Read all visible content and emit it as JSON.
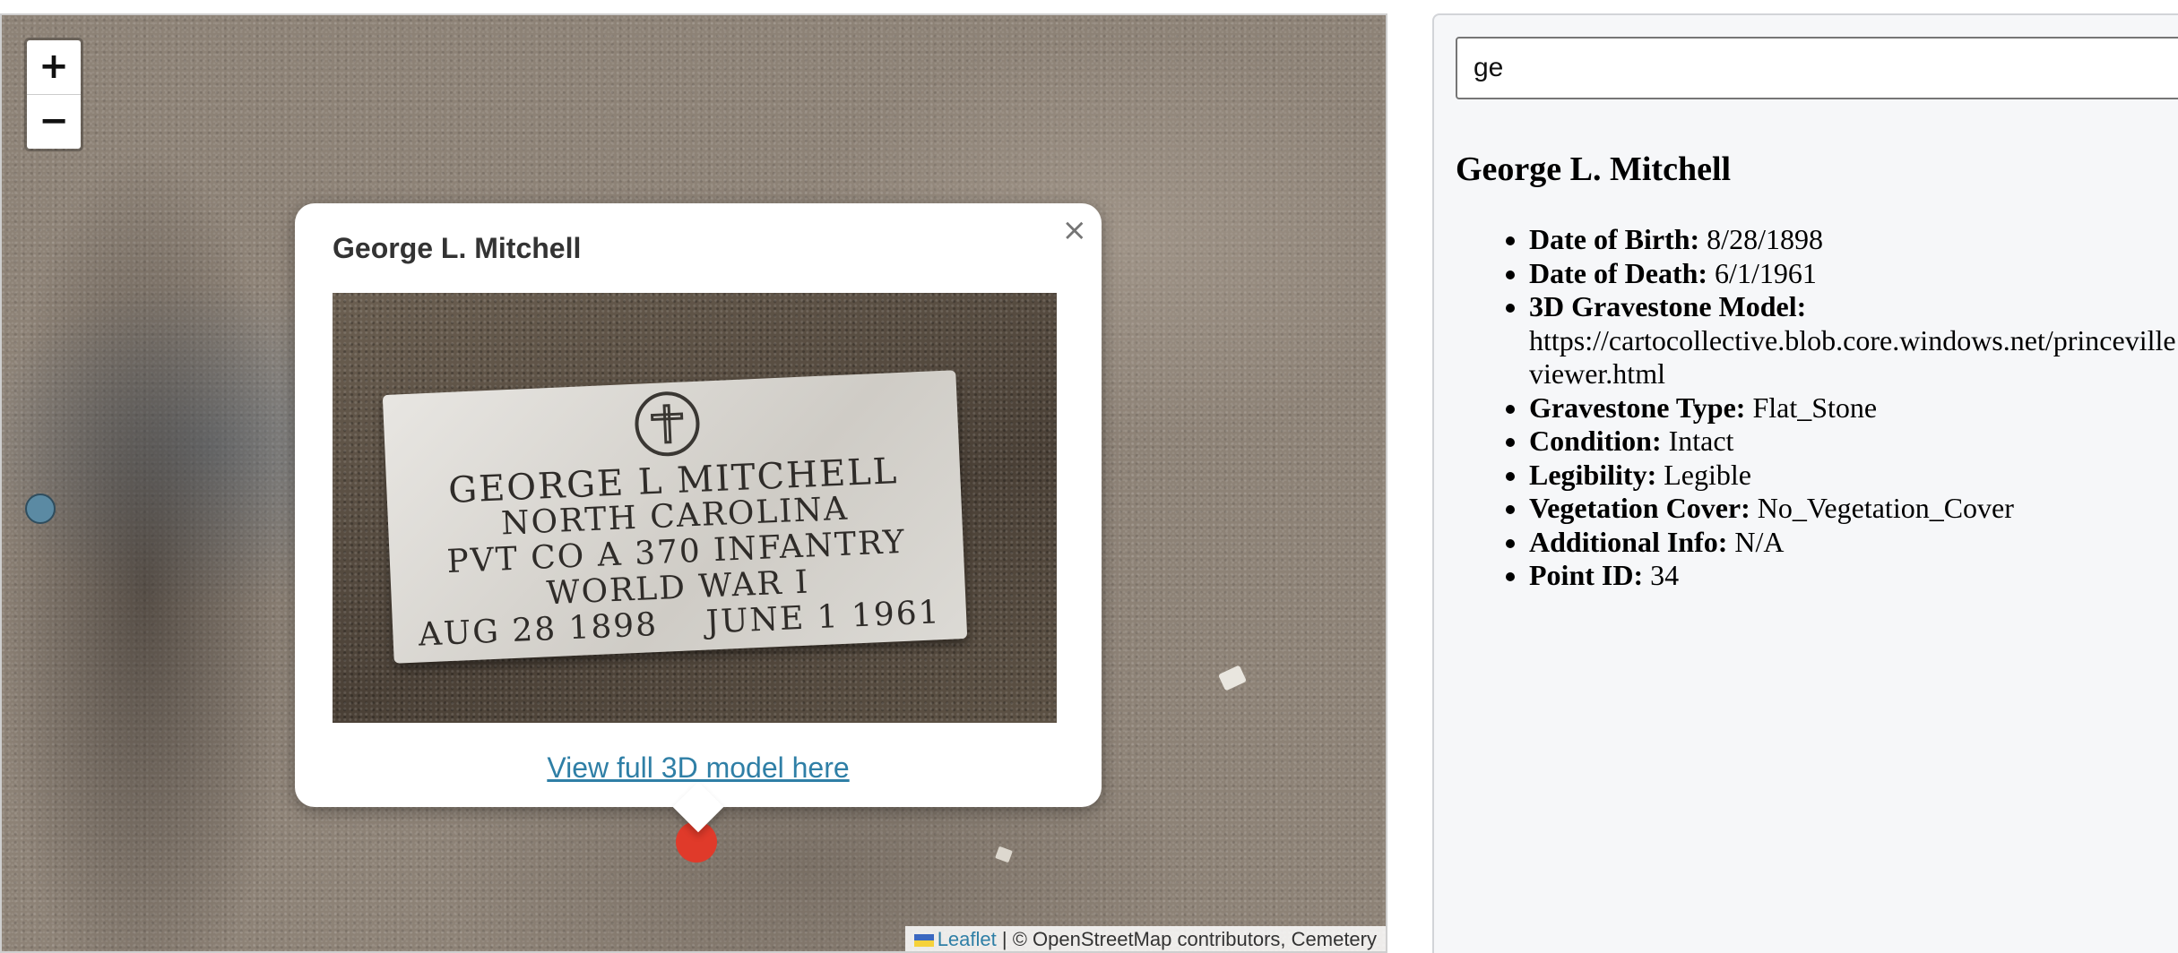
{
  "map": {
    "zoom_in_label": "+",
    "zoom_out_label": "−",
    "attribution": {
      "leaflet": "Leaflet",
      "separator": "|",
      "text": "© OpenStreetMap contributors, Cemetery"
    },
    "popup": {
      "title": "George L. Mitchell",
      "close": "×",
      "stone_lines": [
        "GEORGE L MITCHELL",
        "NORTH CAROLINA",
        "PVT CO A 370 INFANTRY",
        "WORLD WAR I",
        "AUG 28 1898    JUNE 1 1961"
      ],
      "link": "View full 3D model here"
    }
  },
  "sidebar": {
    "search": {
      "value": "ge",
      "placeholder": ""
    },
    "title": "George L. Mitchell",
    "details": [
      {
        "key": "Date of Birth:",
        "value": "8/28/1898"
      },
      {
        "key": "Date of Death:",
        "value": "6/1/1961"
      },
      {
        "key": "3D Gravestone Model:",
        "value": "https://cartocollective.blob.core.windows.net/princeville",
        "value2": "viewer.html"
      },
      {
        "key": "Gravestone Type:",
        "value": "Flat_Stone"
      },
      {
        "key": "Condition:",
        "value": "Intact"
      },
      {
        "key": "Legibility:",
        "value": "Legible"
      },
      {
        "key": "Vegetation Cover:",
        "value": "No_Vegetation_Cover"
      },
      {
        "key": "Additional Info:",
        "value": "N/A"
      },
      {
        "key": "Point ID:",
        "value": "34"
      }
    ]
  },
  "colors": {
    "link": "#2f7fa6",
    "marker_selected": "#e03a2a",
    "marker_default": "#5b8aa3"
  }
}
